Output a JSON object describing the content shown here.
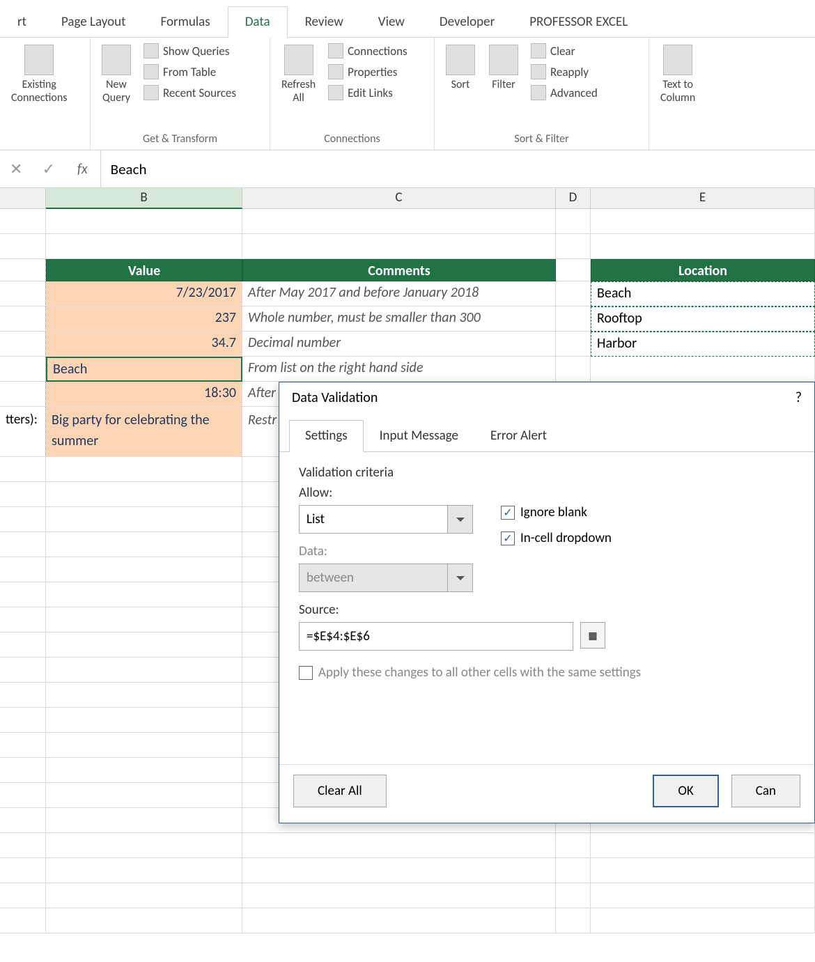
{
  "tabs": [
    "rt",
    "Page Layout",
    "Formulas",
    "Data",
    "Review",
    "View",
    "Developer",
    "PROFESSOR EXCEL"
  ],
  "activeTab": "Data",
  "ribbon": {
    "g1": {
      "btn": "Existing\nConnections"
    },
    "g2": {
      "label": "Get & Transform",
      "big": "New\nQuery",
      "items": [
        "Show Queries",
        "From Table",
        "Recent Sources"
      ]
    },
    "g3": {
      "label": "Connections",
      "big": "Refresh\nAll",
      "items": [
        "Connections",
        "Properties",
        "Edit Links"
      ]
    },
    "g4": {
      "label": "Sort & Filter",
      "sort": "Sort",
      "filter": "Filter",
      "items": [
        "Clear",
        "Reapply",
        "Advanced"
      ]
    },
    "g5": {
      "btn": "Text to\nColumn"
    }
  },
  "formula": {
    "fx": "fx",
    "value": "Beach"
  },
  "cols": [
    "B",
    "C",
    "D",
    "E"
  ],
  "hdrs": {
    "b": "Value",
    "c": "Comments",
    "e": "Location"
  },
  "rows": [
    {
      "b": "7/23/2017",
      "c": "After May 2017 and before January 2018",
      "e": "Beach"
    },
    {
      "b": "237",
      "c": "Whole number, must be smaller than 300",
      "e": "Rooftop"
    },
    {
      "b": "34.7",
      "c": "Decimal number",
      "e": "Harbor"
    },
    {
      "b": "Beach",
      "c": "From list on the right hand side",
      "e": ""
    },
    {
      "b": "18:30",
      "c": "After",
      "e": ""
    },
    {
      "b": "Big party for celebrating the summer",
      "c": "Restr",
      "e": ""
    }
  ],
  "leftstub": "tters):",
  "dialog": {
    "title": "Data Validation",
    "help": "?",
    "tabs": [
      "Settings",
      "Input Message",
      "Error Alert"
    ],
    "criteria_label": "Validation criteria",
    "allow_label": "Allow:",
    "allow_value": "List",
    "data_label": "Data:",
    "data_value": "between",
    "ignore_blank": "Ignore blank",
    "incell": "In-cell dropdown",
    "source_label": "Source:",
    "source_value": "=$E$4:$E$6",
    "apply_all": "Apply these changes to all other cells with the same settings",
    "clear": "Clear All",
    "ok": "OK",
    "cancel": "Can"
  }
}
